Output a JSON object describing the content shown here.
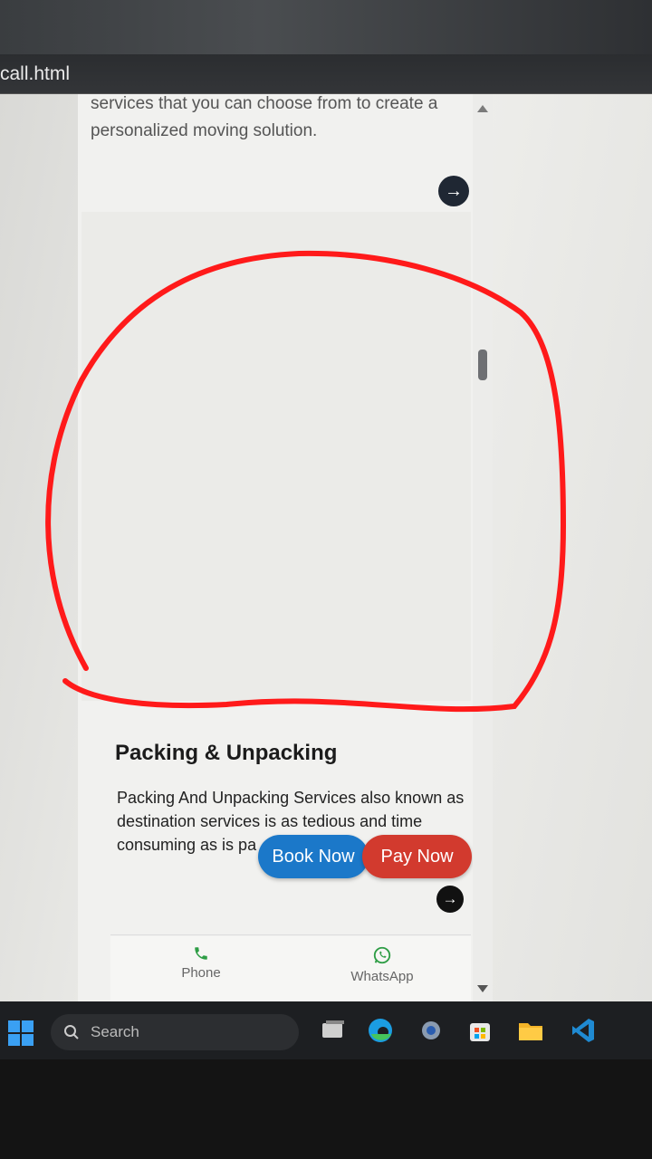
{
  "browser": {
    "tab_title": "call.html"
  },
  "page": {
    "intro_text": "services that you can choose from to create a personalized moving solution.",
    "card": {
      "title": "Packing & Unpacking",
      "description": "Packing And Unpacking Services also known as destination services is as tedious and time consuming as is pa"
    },
    "floating_buttons": {
      "book_label": "Book Now",
      "pay_label": "Pay Now"
    },
    "bottom_nav": [
      {
        "label": "Phone",
        "icon": "phone-icon"
      },
      {
        "label": "WhatsApp",
        "icon": "whatsapp-icon"
      }
    ]
  },
  "taskbar": {
    "search_label": "Search",
    "icons": [
      "windows-start-icon",
      "search-icon",
      "file-explorer-window-icon",
      "edge-icon",
      "settings-icon",
      "store-icon",
      "folder-icon",
      "vscode-icon"
    ]
  },
  "colors": {
    "annotation": "#ff1a1a",
    "book_button": "#1b78c9",
    "pay_button": "#d23a2e",
    "arrow_button": "#1f2733"
  }
}
